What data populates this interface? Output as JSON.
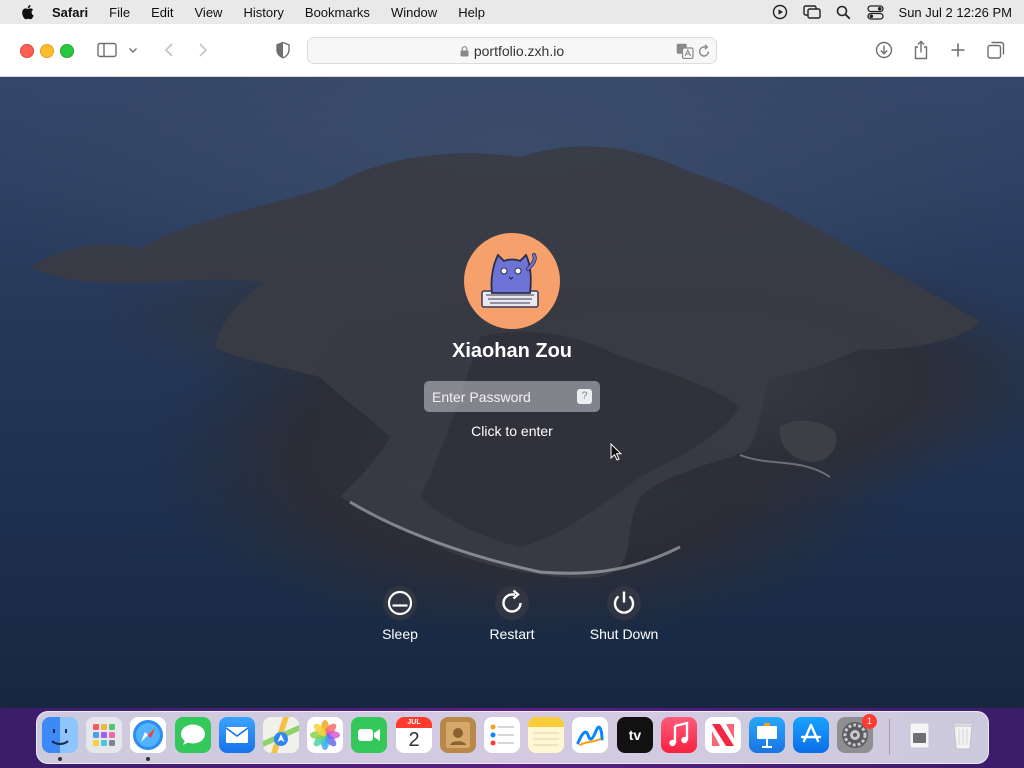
{
  "menubar": {
    "app_name": "Safari",
    "items": [
      "File",
      "Edit",
      "View",
      "History",
      "Bookmarks",
      "Window",
      "Help"
    ],
    "clock": "Sun Jul 2  12:26 PM"
  },
  "toolbar": {
    "url": "portfolio.zxh.io"
  },
  "login": {
    "username": "Xiaohan Zou",
    "password_placeholder": "Enter Password",
    "hint_label": "?",
    "enter_hint": "Click to enter"
  },
  "power": {
    "sleep": "Sleep",
    "restart": "Restart",
    "shutdown": "Shut Down"
  },
  "dock": {
    "calendar_month": "JUL",
    "calendar_day": "2",
    "tv_label": "tv",
    "settings_badge": "1"
  },
  "colors": {
    "traffic_red": "#fe5f57",
    "traffic_yellow": "#febc2e",
    "traffic_green": "#28c840",
    "avatar_bg": "#f6a06b"
  }
}
